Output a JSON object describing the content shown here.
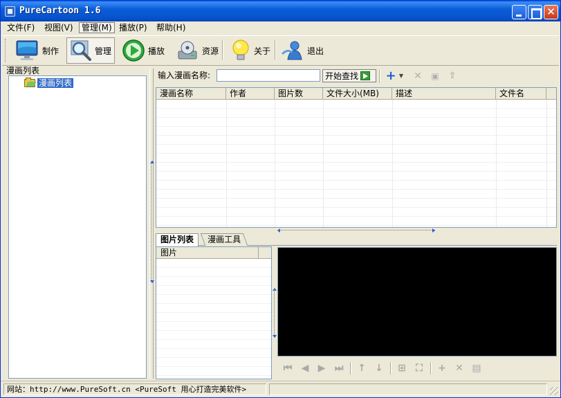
{
  "window": {
    "title": "PureCartoon 1.6"
  },
  "menu": [
    {
      "label": "文件(F)",
      "active": false
    },
    {
      "label": "视图(V)",
      "active": false
    },
    {
      "label": "管理(M)",
      "active": true
    },
    {
      "label": "播放(P)",
      "active": false
    },
    {
      "label": "帮助(H)",
      "active": false
    }
  ],
  "toolbar": {
    "buttons": [
      {
        "label": "制作",
        "icon": "monitor-icon"
      },
      {
        "label": "管理",
        "icon": "magnifier-icon",
        "pressed": true
      },
      {
        "label": "播放",
        "icon": "play-icon"
      },
      {
        "label": "资源",
        "icon": "disk-icon"
      },
      {
        "label": "关于",
        "icon": "lightbulb-icon"
      },
      {
        "label": "退出",
        "icon": "user-exit-icon"
      }
    ]
  },
  "left_panel": {
    "caption": "漫画列表",
    "tree_root": "漫画列表"
  },
  "search": {
    "label": "输入漫画名称:",
    "value": "",
    "button_label": "开始查找"
  },
  "table": {
    "columns": [
      "漫画名称",
      "作者",
      "图片数",
      "文件大小(MB)",
      "描述",
      "文件名"
    ],
    "rows": []
  },
  "tabs": [
    {
      "label": "图片列表",
      "active": true
    },
    {
      "label": "漫画工具",
      "active": false
    }
  ],
  "image_list": {
    "column": "图片"
  },
  "status": {
    "text": "网站：http://www.PureSoft.cn <PureSoft 用心打造完美软件>"
  },
  "colors": {
    "titlebar": "#0a5fdc",
    "selection": "#316ac5",
    "preview_bg": "#000000",
    "accent_icon": "#2a5bd7"
  }
}
